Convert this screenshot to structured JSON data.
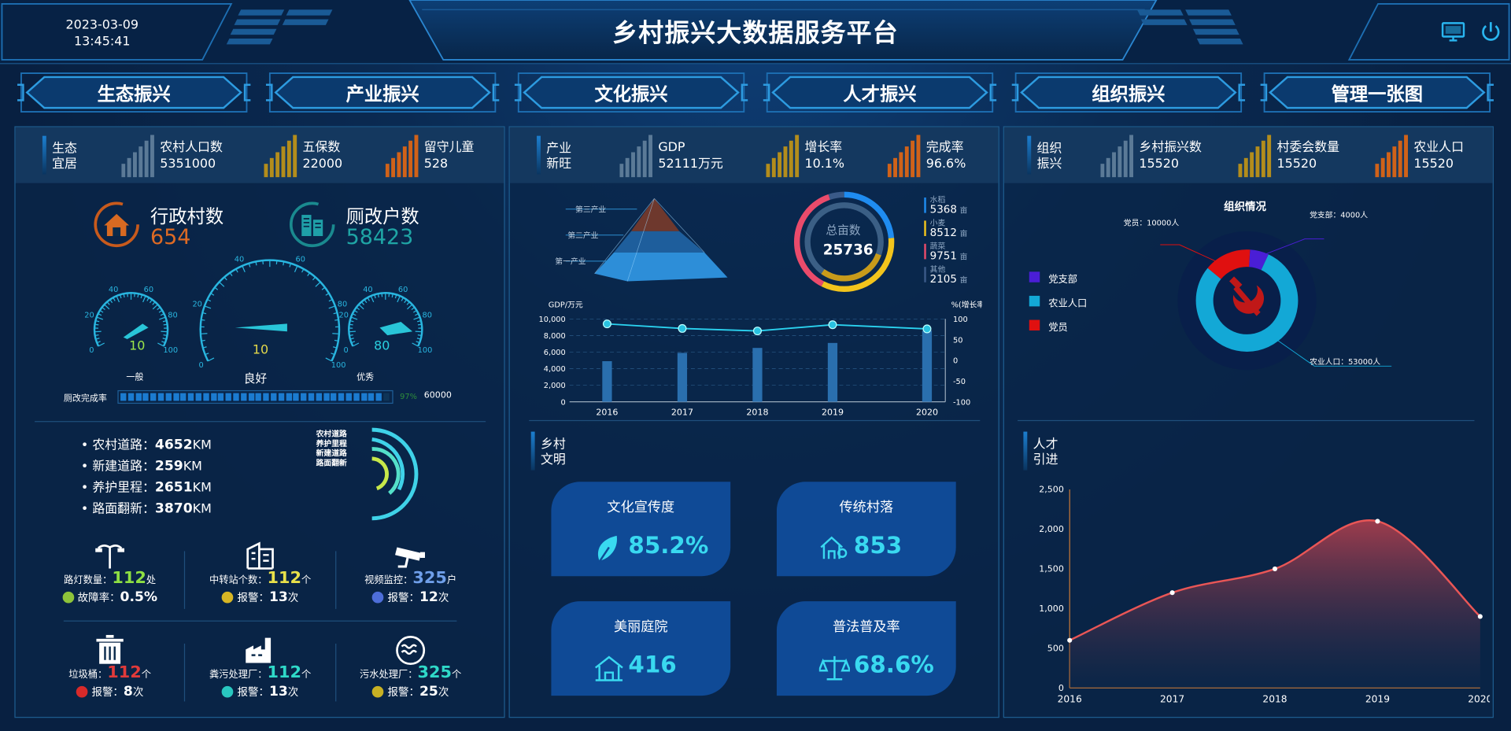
{
  "header": {
    "title": "乡村振兴大数据服务平台",
    "date": "2023-03-09",
    "time": "13:45:41"
  },
  "nav": [
    "生态振兴",
    "产业振兴",
    "文化振兴",
    "人才振兴",
    "组织振兴",
    "管理一张图"
  ],
  "ecology": {
    "title_line1": "生态",
    "title_line2": "宜居",
    "kpis": [
      {
        "name": "农村人口数",
        "value": "5351000",
        "color": "#5b7a97"
      },
      {
        "name": "五保数",
        "value": "22000",
        "color": "#b38d1c"
      },
      {
        "name": "留守儿童",
        "value": "528",
        "color": "#d06219"
      }
    ],
    "villages": {
      "label": "行政村数",
      "value": "654"
    },
    "toilets": {
      "label": "厕改户数",
      "value": "58423"
    },
    "gauges": [
      {
        "label": "一般",
        "value": "10"
      },
      {
        "label": "良好",
        "value": "10"
      },
      {
        "label": "优秀",
        "value": "80"
      }
    ],
    "progress": {
      "label": "厕改完成率",
      "percent": "97%",
      "value": 0.97,
      "total": "60000"
    },
    "roads": [
      {
        "name": "农村道路：",
        "value": "4652",
        "unit": "KM"
      },
      {
        "name": "新建道路：",
        "value": "259",
        "unit": "KM"
      },
      {
        "name": "养护里程：",
        "value": "2651",
        "unit": "KM"
      },
      {
        "name": "路面翻新：",
        "value": "3870",
        "unit": "KM"
      }
    ],
    "road_legend": [
      "农村道路",
      "养护里程",
      "新建道路",
      "路面翻新"
    ],
    "facilities": [
      {
        "name": "路灯数量：",
        "value": "112",
        "unit": "处",
        "sub_label": "故障率：",
        "sub_value": "0.5%",
        "sub_unit": "",
        "value_color": "#8ee043"
      },
      {
        "name": "中转站个数：",
        "value": "112",
        "unit": "个",
        "sub_label": "报警：",
        "sub_value": "13",
        "sub_unit": "次",
        "value_color": "#e8e04a"
      },
      {
        "name": "视频监控：",
        "value": "325",
        "unit": "户",
        "sub_label": "报警：",
        "sub_value": "12",
        "sub_unit": "次",
        "value_color": "#6f9fea"
      },
      {
        "name": "垃圾桶：",
        "value": "112",
        "unit": "个",
        "sub_label": "报警：",
        "sub_value": "8",
        "sub_unit": "次",
        "value_color": "#e13a3a"
      },
      {
        "name": "粪污处理厂：",
        "value": "112",
        "unit": "个",
        "sub_label": "报警：",
        "sub_value": "13",
        "sub_unit": "次",
        "value_color": "#2fd9c8"
      },
      {
        "name": "污水处理厂：",
        "value": "325",
        "unit": "个",
        "sub_label": "报警：",
        "sub_value": "25",
        "sub_unit": "次",
        "value_color": "#2fd9c8"
      }
    ]
  },
  "industry": {
    "title_line1": "产业",
    "title_line2": "新旺",
    "kpis": [
      {
        "name": "GDP",
        "value": "52111万元",
        "color": "#5b7a97"
      },
      {
        "name": "增长率",
        "value": "10.1%",
        "color": "#b38d1c"
      },
      {
        "name": "完成率",
        "value": "96.6%",
        "color": "#d06219"
      }
    ],
    "pyramid": [
      "第三产业",
      "第二产业",
      "第一产业"
    ],
    "donut": {
      "label": "总亩数",
      "value": "25736",
      "items": [
        {
          "name": "水稻",
          "value": "5368",
          "unit": "亩",
          "color": "#1f8cf0"
        },
        {
          "name": "小麦",
          "value": "8512",
          "unit": "亩",
          "color": "#f2c41c"
        },
        {
          "name": "蔬菜",
          "value": "9751",
          "unit": "亩",
          "color": "#ea4b6b"
        },
        {
          "name": "其他",
          "value": "2105",
          "unit": "亩",
          "color": "#3a5a88"
        }
      ]
    }
  },
  "culture": {
    "title_line1": "乡村",
    "title_line2": "文明",
    "cards": [
      {
        "title": "文化宣传度",
        "value": "85.2%",
        "icon": "leaf-icon"
      },
      {
        "title": "传统村落",
        "value": "853",
        "icon": "village-icon"
      },
      {
        "title": "美丽庭院",
        "value": "416",
        "icon": "house-icon"
      },
      {
        "title": "普法普及率",
        "value": "68.6%",
        "icon": "scales-icon"
      }
    ]
  },
  "organization": {
    "title_line1": "组织",
    "title_line2": "振兴",
    "kpis": [
      {
        "name": "乡村振兴数",
        "value": "15520",
        "color": "#5b7a97"
      },
      {
        "name": "村委会数量",
        "value": "15520",
        "color": "#b38d1c"
      },
      {
        "name": "农业人口",
        "value": "15520",
        "color": "#d06219"
      }
    ],
    "chart_title": "组织情况",
    "legend": [
      {
        "name": "党支部",
        "color": "#4a1ed6"
      },
      {
        "name": "农业人口",
        "color": "#13a8d6"
      },
      {
        "name": "党员",
        "color": "#e01010"
      }
    ],
    "callouts": [
      {
        "text": "党员：10000人"
      },
      {
        "text": "党支部：4000人"
      },
      {
        "text": "农业人口：53000人"
      }
    ]
  },
  "talent": {
    "title_line1": "人才",
    "title_line2": "引进"
  },
  "chart_data": [
    {
      "type": "bar",
      "ylabel": "GDP/万元",
      "y2label": "%(增长率)",
      "categories": [
        "2016",
        "2017",
        "2018",
        "2019",
        "2020"
      ],
      "series": [
        {
          "values": [
            4900,
            5900,
            6500,
            7100,
            8600
          ],
          "color": "#2a6fae"
        },
        {
          "type": "line",
          "axis": "right",
          "values": [
            88,
            77,
            71,
            86,
            76
          ],
          "color": "#2bd3f0"
        }
      ],
      "ylim": [
        0,
        10000
      ],
      "yticks": [
        "10,000",
        "8,000",
        "6,000",
        "4,000",
        "2,000",
        "0"
      ],
      "y2lim": [
        -100,
        100
      ],
      "y2ticks": [
        "100",
        "50",
        "0",
        "-50",
        "-100"
      ]
    },
    {
      "type": "pie",
      "title": "组织情况",
      "values": [
        {
          "name": "党支部",
          "value": 4000
        },
        {
          "name": "农业人口",
          "value": 53000
        },
        {
          "name": "党员",
          "value": 10000
        }
      ]
    },
    {
      "type": "area",
      "categories": [
        "2016",
        "2017",
        "2018",
        "2019",
        "2020"
      ],
      "values": [
        600,
        1200,
        1500,
        2100,
        900
      ],
      "ylim": [
        0,
        2500
      ],
      "yticks": [
        "2,500",
        "2,000",
        "1,500",
        "1,000",
        "500",
        "0"
      ],
      "color": "#e95656"
    }
  ]
}
